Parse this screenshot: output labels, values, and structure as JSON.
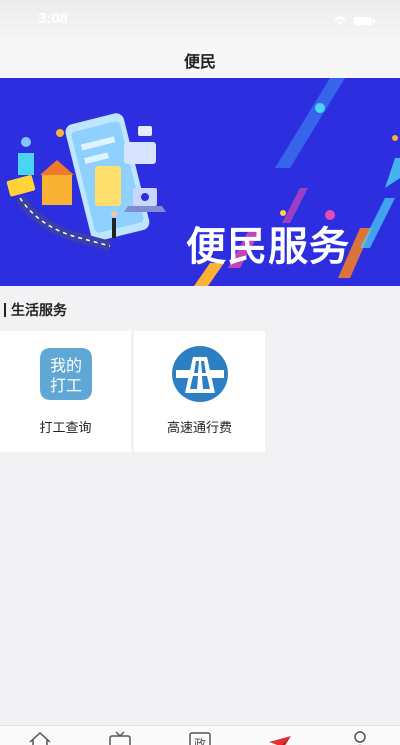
{
  "status_bar": {
    "time": "3:08"
  },
  "header": {
    "title": "便民"
  },
  "banner": {
    "text": "便民服务"
  },
  "section": {
    "title": "生活服务"
  },
  "services": [
    {
      "label": "打工查询",
      "icon": "my-work-icon",
      "icon_text_1": "我的",
      "icon_text_2": "打工",
      "color": "#5fa8d6"
    },
    {
      "label": "高速通行费",
      "icon": "highway-icon",
      "color": "#2c7fc2"
    }
  ],
  "tabs": [
    {
      "icon": "home-icon"
    },
    {
      "icon": "tv-icon"
    },
    {
      "icon": "government-icon",
      "text": "政"
    },
    {
      "icon": "paper-plane-icon",
      "active": true,
      "color": "#e03232"
    },
    {
      "icon": "user-icon"
    }
  ]
}
